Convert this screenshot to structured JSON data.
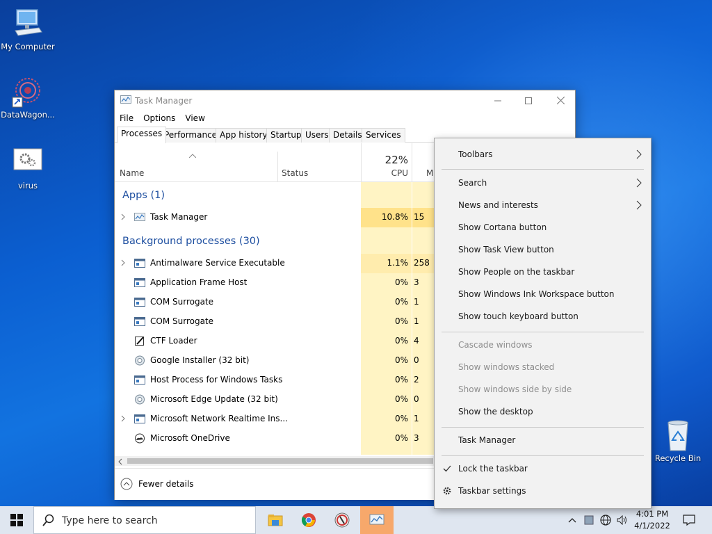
{
  "desktop": {
    "icons": [
      {
        "label": "My Computer"
      },
      {
        "label": "DataWagon..."
      },
      {
        "label": "virus"
      },
      {
        "label": "Recycle Bin"
      }
    ]
  },
  "task_manager": {
    "title": "Task Manager",
    "menu": [
      "File",
      "Options",
      "View"
    ],
    "tabs": [
      "Processes",
      "Performance",
      "App history",
      "Startup",
      "Users",
      "Details",
      "Services"
    ],
    "active_tab": "Processes",
    "columns": {
      "name": "Name",
      "status": "Status",
      "cpu_percent": "22%",
      "cpu": "CPU",
      "memory_partial": "M"
    },
    "groups": {
      "apps": "Apps (1)",
      "background": "Background processes (30)"
    },
    "apps": [
      {
        "name": "Task Manager",
        "cpu": "10.8%",
        "mem": "15",
        "expandable": true
      }
    ],
    "background": [
      {
        "name": "Antimalware Service Executable",
        "cpu": "1.1%",
        "mem": "258",
        "expandable": true
      },
      {
        "name": "Application Frame Host",
        "cpu": "0%",
        "mem": "3",
        "expandable": false
      },
      {
        "name": "COM Surrogate",
        "cpu": "0%",
        "mem": "1",
        "expandable": false
      },
      {
        "name": "COM Surrogate",
        "cpu": "0%",
        "mem": "1",
        "expandable": false
      },
      {
        "name": "CTF Loader",
        "cpu": "0%",
        "mem": "4",
        "expandable": false
      },
      {
        "name": "Google Installer (32 bit)",
        "cpu": "0%",
        "mem": "0",
        "expandable": false
      },
      {
        "name": "Host Process for Windows Tasks",
        "cpu": "0%",
        "mem": "2",
        "expandable": false
      },
      {
        "name": "Microsoft Edge Update (32 bit)",
        "cpu": "0%",
        "mem": "0",
        "expandable": false
      },
      {
        "name": "Microsoft Network Realtime Ins...",
        "cpu": "0%",
        "mem": "1",
        "expandable": true
      },
      {
        "name": "Microsoft OneDrive",
        "cpu": "0%",
        "mem": "3",
        "expandable": false
      }
    ],
    "fewer_details": "Fewer details"
  },
  "context_menu": {
    "items": [
      {
        "label": "Toolbars",
        "submenu": true,
        "disabled": false
      },
      {
        "label": "Search",
        "submenu": true,
        "disabled": false
      },
      {
        "label": "News and interests",
        "submenu": true,
        "disabled": false
      },
      {
        "label": "Show Cortana button",
        "disabled": false
      },
      {
        "label": "Show Task View button",
        "disabled": false
      },
      {
        "label": "Show People on the taskbar",
        "disabled": false
      },
      {
        "label": "Show Windows Ink Workspace button",
        "disabled": false
      },
      {
        "label": "Show touch keyboard button",
        "disabled": false
      },
      {
        "label": "Cascade windows",
        "disabled": true
      },
      {
        "label": "Show windows stacked",
        "disabled": true
      },
      {
        "label": "Show windows side by side",
        "disabled": true
      },
      {
        "label": "Show the desktop",
        "disabled": false
      },
      {
        "label": "Task Manager",
        "disabled": false
      },
      {
        "label": "Lock the taskbar",
        "checked": true,
        "disabled": false
      },
      {
        "label": "Taskbar settings",
        "icon": "gear-icon",
        "disabled": false
      }
    ]
  },
  "taskbar": {
    "search_placeholder": "Type here to search",
    "apps": [
      "file-explorer-icon",
      "chrome-icon",
      "app-icon",
      "task-manager-icon"
    ],
    "clock": {
      "time": "4:01 PM",
      "date": "4/1/2022"
    },
    "colors": {
      "active_app": "#f7a86b",
      "taskbar": "#dfe6f0"
    }
  }
}
